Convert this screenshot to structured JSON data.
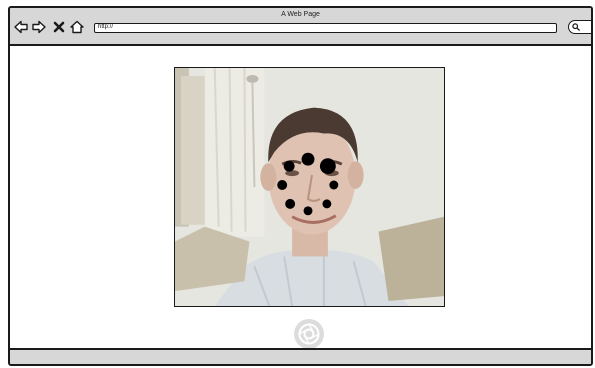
{
  "browser": {
    "title": "A Web Page",
    "url": "http://",
    "nav_icons": [
      "back-arrow-icon",
      "forward-arrow-icon",
      "close-x-icon",
      "home-icon"
    ],
    "search_icon": "search-icon"
  },
  "main": {
    "photo": "webcam-portrait",
    "overlay": "loading-spinner-icon",
    "capture_icon": "camera-shutter-icon"
  },
  "colors": {
    "chrome": "#d7d7d7",
    "outline": "#1a1a1a",
    "spinner": "#000000",
    "capture_button": "#dcdcdc"
  }
}
